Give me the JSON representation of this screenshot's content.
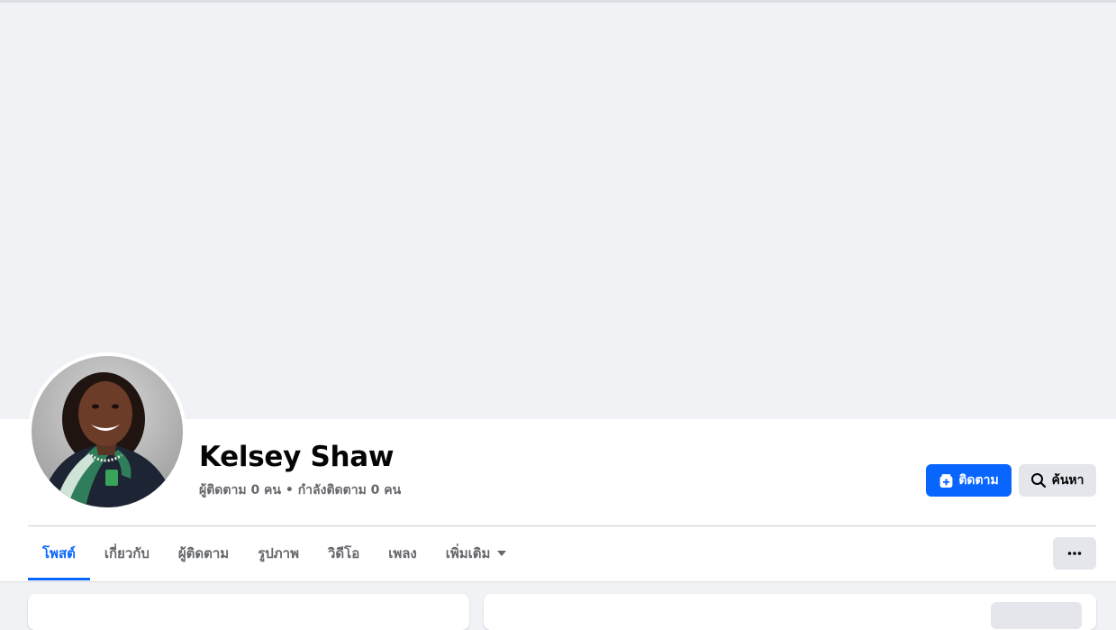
{
  "profile": {
    "name": "Kelsey Shaw",
    "stats": "ผู้ติดตาม 0 คน • กำลังติดตาม 0 คน"
  },
  "actions": {
    "follow_label": "ติดตาม",
    "search_label": "ค้นหา"
  },
  "tabs": [
    {
      "label": "โพสต์",
      "active": true
    },
    {
      "label": "เกี่ยวกับ",
      "active": false
    },
    {
      "label": "ผู้ติดตาม",
      "active": false
    },
    {
      "label": "รูปภาพ",
      "active": false
    },
    {
      "label": "วิดีโอ",
      "active": false
    },
    {
      "label": "เพลง",
      "active": false
    },
    {
      "label": "เพิ่มเติม",
      "active": false
    }
  ],
  "icons": {
    "follow": "follow-plus-icon",
    "search": "search-icon",
    "more_tab": "caret-down-icon",
    "more_menu": "ellipsis-icon"
  },
  "colors": {
    "accent": "#0866ff",
    "secondary_text": "#65676b",
    "primary_text": "#050505",
    "button_gray": "#e4e6eb",
    "page_bg": "#f0f2f5"
  }
}
